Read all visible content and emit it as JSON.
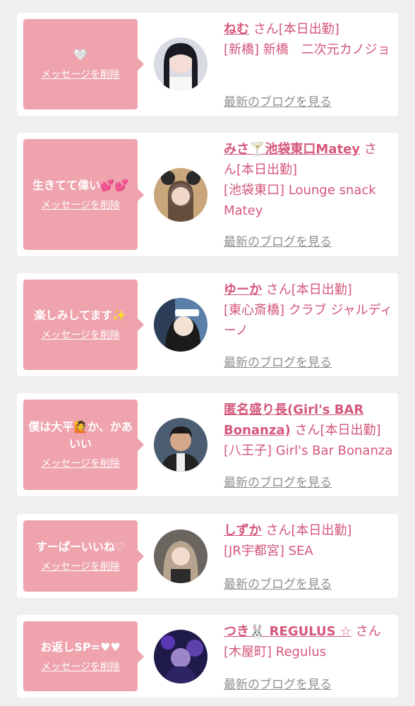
{
  "cards": [
    {
      "message": "🤍",
      "delete_label": "メッセージを削除",
      "name": "ねむ",
      "honorific": "さん",
      "status": "[本日出勤]",
      "shop_line": "[新橋] 新橋　二次元カノジョ",
      "blog_label": "最新のブログを見る"
    },
    {
      "message": "生きてて偉い💕💕",
      "delete_label": "メッセージを削除",
      "name": "みさ🍸池袋東口Matey",
      "honorific": "さ",
      "status": "ん[本日出勤]",
      "shop_line": "[池袋東口] Lounge snack Matey",
      "blog_label": "最新のブログを見る"
    },
    {
      "message": "楽しみしてます✨",
      "delete_label": "メッセージを削除",
      "name": "ゆーか",
      "honorific": "さん",
      "status": "[本日出勤]",
      "shop_line": "[東心斎橋] クラブ ジャルディーノ",
      "blog_label": "最新のブログを見る"
    },
    {
      "message": "僕は大平🙋か、かあいい",
      "delete_label": "メッセージを削除",
      "name": "匿名盛り長(Girl's BAR Bonanza)",
      "honorific": "さん",
      "status": "[本日出勤]",
      "shop_line": "[八王子] Girl's Bar Bonanza",
      "blog_label": "最新のブログを見る"
    },
    {
      "message": "すーぱーいいね♡",
      "delete_label": "メッセージを削除",
      "name": "しずか",
      "honorific": "さん",
      "status": "[本日出勤]",
      "shop_line": "[JR宇都宮] SEA",
      "blog_label": "最新のブログを見る"
    },
    {
      "message": "お返しSP=♥♥",
      "delete_label": "メッセージを削除",
      "name": "つき🐰 REGULUS ☆",
      "honorific": "さん",
      "status": "",
      "shop_line": "[木屋町] Regulus",
      "blog_label": "最新のブログを見る"
    }
  ],
  "colors": {
    "bubble": "#eea3ad",
    "accent": "#d4577a",
    "link_gray": "#8f8f8f",
    "background": "#efefef"
  }
}
